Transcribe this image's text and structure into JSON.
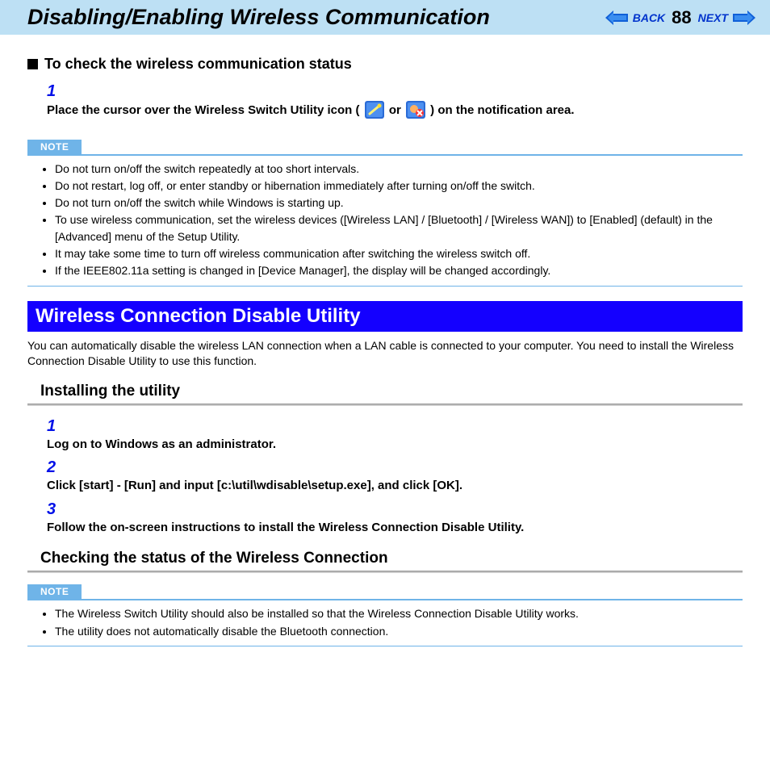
{
  "header": {
    "title": "Disabling/Enabling Wireless Communication",
    "back": "BACK",
    "next": "NEXT",
    "page": "88"
  },
  "section1": {
    "heading": "To check the wireless communication status",
    "steps": [
      {
        "n": "1",
        "pre": "Place the cursor over the Wireless Switch Utility icon (",
        "mid": " or ",
        "post": ") on the notification area."
      }
    ]
  },
  "noteLabel": "NOTE",
  "note1": [
    "Do not turn on/off the switch repeatedly at too short intervals.",
    "Do not restart, log off, or enter standby or hibernation immediately after turning on/off the switch.",
    "Do not turn on/off the switch while Windows is starting up.",
    "To use wireless communication, set the wireless devices ([Wireless LAN] / [Bluetooth] / [Wireless WAN]) to [Enabled] (default) in the [Advanced] menu of the Setup Utility.",
    "It may take some time to turn off wireless communication after switching the wireless switch off.",
    "If the IEEE802.11a setting is changed in [Device Manager], the display will be changed accordingly."
  ],
  "blueBar": "Wireless Connection Disable Utility",
  "intro": "You can automatically disable the wireless LAN connection when a LAN cable is connected to your computer. You need to install the Wireless Connection Disable Utility to use this function.",
  "install": {
    "heading": "Installing the utility",
    "steps": [
      {
        "n": "1",
        "t": "Log on to Windows as an administrator."
      },
      {
        "n": "2",
        "t": "Click [start] - [Run] and input [c:\\util\\wdisable\\setup.exe], and click [OK]."
      },
      {
        "n": "3",
        "t": "Follow the on-screen instructions to install the Wireless Connection Disable Utility."
      }
    ]
  },
  "check": {
    "heading": "Checking the status of the Wireless Connection"
  },
  "note2": [
    "The Wireless Switch Utility should also be installed so that the Wireless Connection Disable Utility works.",
    "The utility does not automatically disable the Bluetooth connection."
  ]
}
